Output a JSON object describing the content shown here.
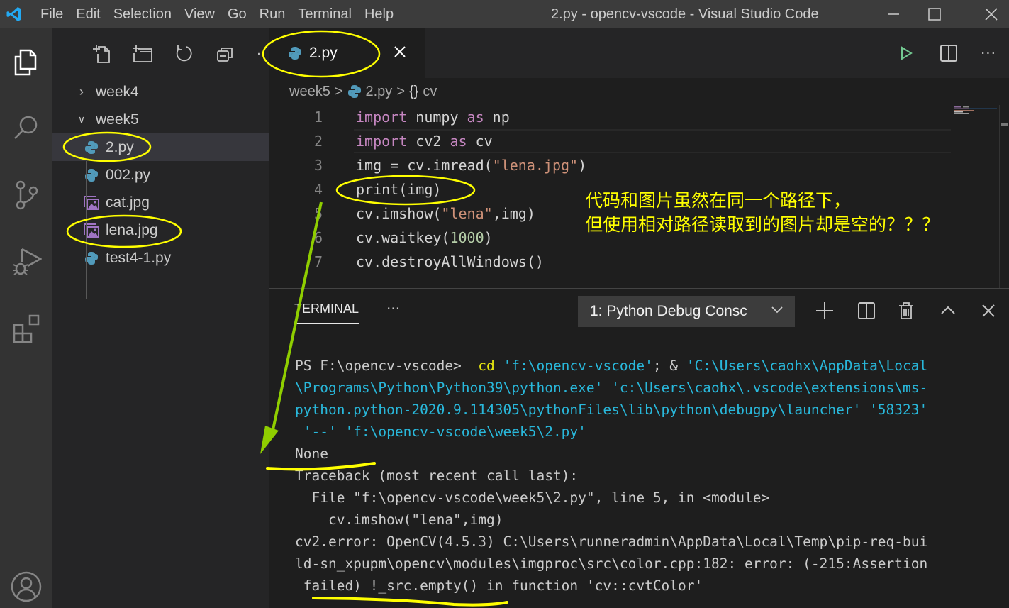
{
  "window": {
    "title": "2.py - opencv-vscode - Visual Studio Code",
    "menu": [
      "File",
      "Edit",
      "Selection",
      "View",
      "Go",
      "Run",
      "Terminal",
      "Help"
    ],
    "controls": [
      "minimize",
      "maximize",
      "close"
    ]
  },
  "activity_bar": {
    "items": [
      "explorer-icon",
      "search-icon",
      "source-control-icon",
      "run-debug-icon",
      "extensions-icon"
    ],
    "bottom": [
      "accounts-icon"
    ]
  },
  "explorer": {
    "toolbar": [
      "new-file-icon",
      "new-folder-icon",
      "refresh-icon",
      "collapse-all-icon",
      "more-icon"
    ],
    "tree": [
      {
        "label": "week4",
        "type": "folder",
        "expanded": false
      },
      {
        "label": "week5",
        "type": "folder",
        "expanded": true
      },
      {
        "label": "2.py",
        "type": "python",
        "selected": true,
        "highlighted": true
      },
      {
        "label": "002.py",
        "type": "python"
      },
      {
        "label": "cat.jpg",
        "type": "image"
      },
      {
        "label": "lena.jpg",
        "type": "image",
        "highlighted": true
      },
      {
        "label": "test4-1.py",
        "type": "python"
      }
    ]
  },
  "editor": {
    "tab": {
      "label": "2.py",
      "close": "×"
    },
    "toolbar": [
      "run-icon",
      "split-editor-icon",
      "more-actions-icon"
    ],
    "breadcrumb": [
      "week5",
      ">",
      "2.py",
      ">",
      "{}",
      "cv"
    ],
    "lines": [
      {
        "n": "1",
        "tokens": [
          [
            "kw",
            "import"
          ],
          [
            "p",
            " numpy "
          ],
          [
            "kw",
            "as"
          ],
          [
            "p",
            " np"
          ]
        ]
      },
      {
        "n": "2",
        "tokens": [
          [
            "kw",
            "import"
          ],
          [
            "p",
            " cv2 "
          ],
          [
            "kw",
            "as"
          ],
          [
            "p",
            " cv"
          ]
        ]
      },
      {
        "n": "3",
        "tokens": [
          [
            "p",
            "img = cv.imread("
          ],
          [
            "str",
            "\"lena.jpg\""
          ],
          [
            "p",
            ")"
          ]
        ]
      },
      {
        "n": "4",
        "tokens": [
          [
            "p",
            "print(img)"
          ]
        ]
      },
      {
        "n": "5",
        "tokens": [
          [
            "p",
            "cv.imshow("
          ],
          [
            "str",
            "\"lena\""
          ],
          [
            "p",
            ",img)"
          ]
        ]
      },
      {
        "n": "6",
        "tokens": [
          [
            "p",
            "cv.waitkey("
          ],
          [
            "num",
            "1000"
          ],
          [
            "p",
            ")"
          ]
        ]
      },
      {
        "n": "7",
        "tokens": [
          [
            "p",
            "cv.destroyAllWindows()"
          ]
        ]
      }
    ]
  },
  "panel": {
    "tab": "TERMINAL",
    "more": "···",
    "terminal_select": "1: Python Debug Consc",
    "tools": [
      "new-terminal-icon",
      "split-terminal-icon",
      "kill-terminal-icon",
      "maximize-panel-icon",
      "close-panel-icon"
    ],
    "output": [
      [
        [
          "p",
          "PS F:\\opencv-vscode>  "
        ],
        [
          "y",
          "cd"
        ],
        [
          "c",
          " 'f:\\opencv-vscode'"
        ],
        [
          "p",
          "; & "
        ],
        [
          "c",
          "'C:\\Users\\caohx\\AppData\\Local"
        ]
      ],
      [
        [
          "c",
          "\\Programs\\Python\\Python39\\python.exe' 'c:\\Users\\caohx\\.vscode\\extensions\\ms-"
        ]
      ],
      [
        [
          "c",
          "python.python-2020.9.114305\\pythonFiles\\lib\\python\\debugpy\\launcher' '58323'"
        ]
      ],
      [
        [
          "c",
          " '--' 'f:\\opencv-vscode\\week5\\2.py'"
        ]
      ],
      [
        [
          "p",
          "None"
        ]
      ],
      [
        [
          "p",
          "Traceback (most recent call last):"
        ]
      ],
      [
        [
          "p",
          "  File \"f:\\opencv-vscode\\week5\\2.py\", line 5, in <module>"
        ]
      ],
      [
        [
          "p",
          "    cv.imshow(\"lena\",img)"
        ]
      ],
      [
        [
          "p",
          "cv2.error: OpenCV(4.5.3) C:\\Users\\runneradmin\\AppData\\Local\\Temp\\pip-req-bui"
        ]
      ],
      [
        [
          "p",
          "ld-sn_xpupm\\opencv\\modules\\imgproc\\src\\color.cpp:182: error: (-215:Assertion"
        ]
      ],
      [
        [
          "p",
          " failed) !_src.empty() in function 'cv::cvtColor'"
        ]
      ]
    ]
  },
  "annotation": {
    "note": "代码和图片虽然在同一个路径下，\n但使用相对路径读取到的图片却是空的？？？",
    "color": "#ffff00",
    "arrow_color": "#8fce00"
  }
}
